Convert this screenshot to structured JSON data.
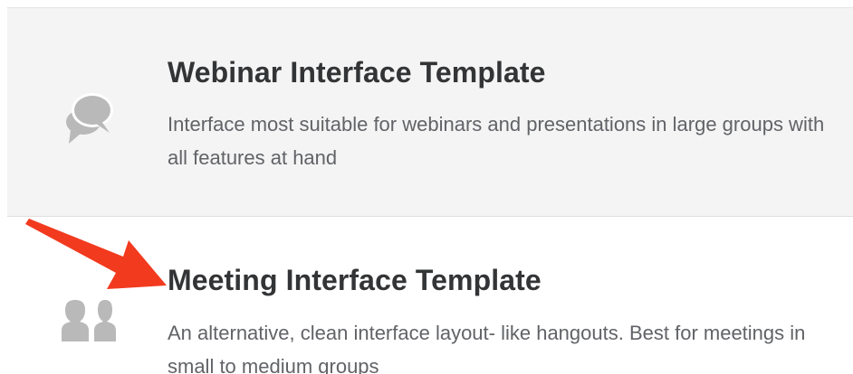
{
  "options": [
    {
      "title": "Webinar Interface Template",
      "description": "Interface most suitable for webinars and presentations in large groups with all features at hand",
      "icon": "chat-bubbles-icon",
      "selected": true
    },
    {
      "title": "Meeting Interface Template",
      "description": "An alternative, clean interface layout- like hangouts. Best for meetings in small to medium groups",
      "icon": "people-icon",
      "selected": false
    }
  ],
  "annotation": {
    "icon": "pointer-arrow-icon",
    "color": "#f23a1f"
  },
  "colors": {
    "selected_background": "#f4f4f4",
    "title": "#333436",
    "description": "#616367",
    "icon": "#b9b9b9"
  }
}
